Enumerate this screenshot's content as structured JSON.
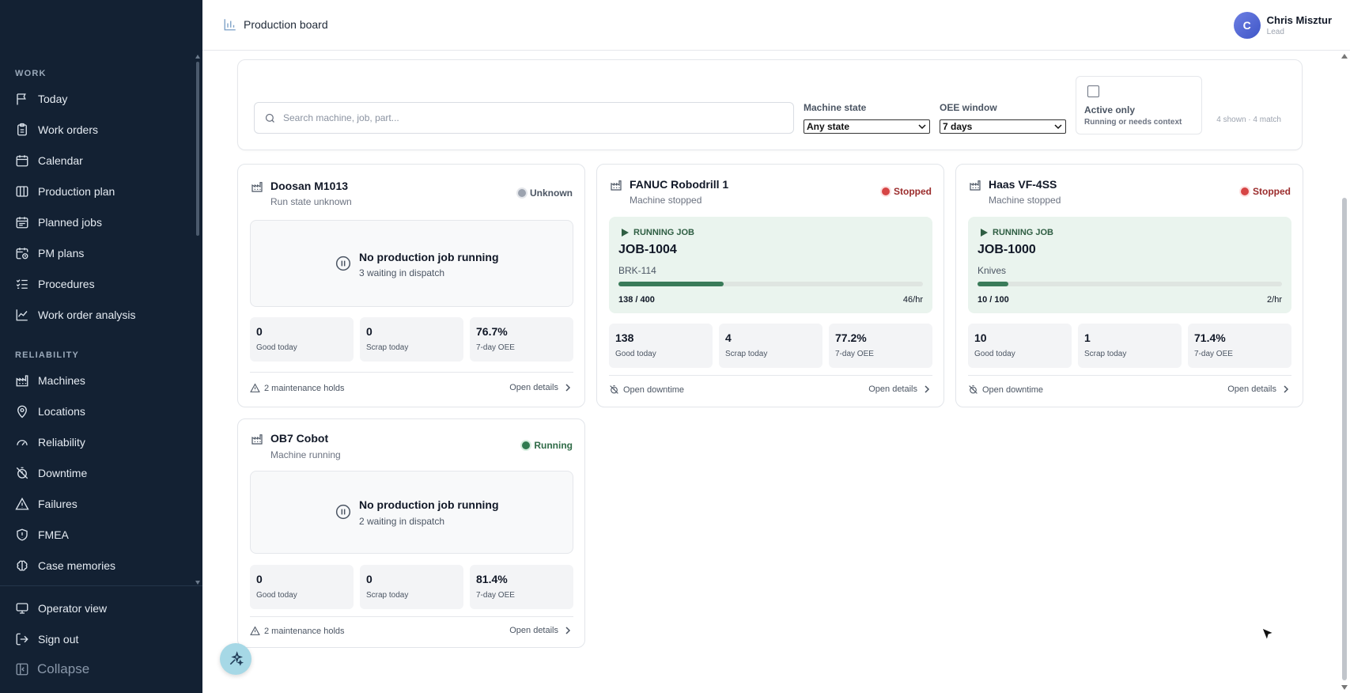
{
  "header": {
    "title": "Production board",
    "user": {
      "initial": "C",
      "name": "Chris Misztur",
      "role": "Lead"
    }
  },
  "sidebar": {
    "sections": [
      {
        "label": "WORK",
        "items": [
          {
            "label": "Today",
            "icon": "flag-icon"
          },
          {
            "label": "Work orders",
            "icon": "clipboard-icon"
          },
          {
            "label": "Calendar",
            "icon": "calendar-icon"
          },
          {
            "label": "Production plan",
            "icon": "columns-icon"
          },
          {
            "label": "Planned jobs",
            "icon": "calendar-list-icon"
          },
          {
            "label": "PM plans",
            "icon": "calendar-clock-icon"
          },
          {
            "label": "Procedures",
            "icon": "checklist-icon"
          },
          {
            "label": "Work order analysis",
            "icon": "line-chart-icon"
          }
        ]
      },
      {
        "label": "RELIABILITY",
        "items": [
          {
            "label": "Machines",
            "icon": "factory-icon"
          },
          {
            "label": "Locations",
            "icon": "map-pin-icon"
          },
          {
            "label": "Reliability",
            "icon": "gauge-icon"
          },
          {
            "label": "Downtime",
            "icon": "timer-off-icon"
          },
          {
            "label": "Failures",
            "icon": "warning-icon"
          },
          {
            "label": "FMEA",
            "icon": "shield-icon"
          },
          {
            "label": "Case memories",
            "icon": "brain-icon"
          }
        ]
      }
    ],
    "bottom": [
      {
        "label": "Operator view",
        "icon": "monitor-icon"
      },
      {
        "label": "Sign out",
        "icon": "sign-out-icon"
      }
    ],
    "collapse_label": "Collapse"
  },
  "filters": {
    "search_placeholder": "Search machine, job, part...",
    "machine_state_label": "Machine state",
    "machine_state_value": "Any state",
    "oee_window_label": "OEE window",
    "oee_window_value": "7 days",
    "active_only_title": "Active only",
    "active_only_sub": "Running or needs context",
    "active_only_checked": false,
    "match_text": "4 shown · 4 match"
  },
  "machines": [
    {
      "name": "Doosan M1013",
      "subtitle": "Run state unknown",
      "state": "Unknown",
      "state_color": "#9ca3af",
      "state_text_color": "#4b5563",
      "empty_title": "No production job running",
      "empty_sub": "3 waiting in dispatch",
      "stats": [
        {
          "value": "0",
          "label": "Good today"
        },
        {
          "value": "0",
          "label": "Scrap today"
        },
        {
          "value": "76.7%",
          "label": "7-day OEE"
        }
      ],
      "footer_left": "2 maintenance holds",
      "footer_right": "Open details"
    },
    {
      "name": "FANUC Robodrill 1",
      "subtitle": "Machine stopped",
      "state": "Stopped",
      "state_color": "#d64545",
      "state_text_color": "#9b2c2c",
      "job": {
        "tag": "RUNNING JOB",
        "id": "JOB-1004",
        "part": "BRK-114",
        "count": "138 / 400",
        "rate": "46/hr",
        "progress": 0.345
      },
      "stats": [
        {
          "value": "138",
          "label": "Good today"
        },
        {
          "value": "4",
          "label": "Scrap today"
        },
        {
          "value": "77.2%",
          "label": "7-day OEE"
        }
      ],
      "footer_left": "Open downtime",
      "footer_right": "Open details"
    },
    {
      "name": "Haas VF-4SS",
      "subtitle": "Machine stopped",
      "state": "Stopped",
      "state_color": "#d64545",
      "state_text_color": "#9b2c2c",
      "job": {
        "tag": "RUNNING JOB",
        "id": "JOB-1000",
        "part": "Knives",
        "count": "10 / 100",
        "rate": "2/hr",
        "progress": 0.1
      },
      "stats": [
        {
          "value": "10",
          "label": "Good today"
        },
        {
          "value": "1",
          "label": "Scrap today"
        },
        {
          "value": "71.4%",
          "label": "7-day OEE"
        }
      ],
      "footer_left": "Open downtime",
      "footer_right": "Open details"
    },
    {
      "name": "OB7 Cobot",
      "subtitle": "Machine running",
      "state": "Running",
      "state_color": "#2f7a4f",
      "state_text_color": "#2f6b47",
      "empty_title": "No production job running",
      "empty_sub": "2 waiting in dispatch",
      "stats": [
        {
          "value": "0",
          "label": "Good today"
        },
        {
          "value": "0",
          "label": "Scrap today"
        },
        {
          "value": "81.4%",
          "label": "7-day OEE"
        }
      ],
      "footer_left": "2 maintenance holds",
      "footer_right": "Open details"
    }
  ]
}
